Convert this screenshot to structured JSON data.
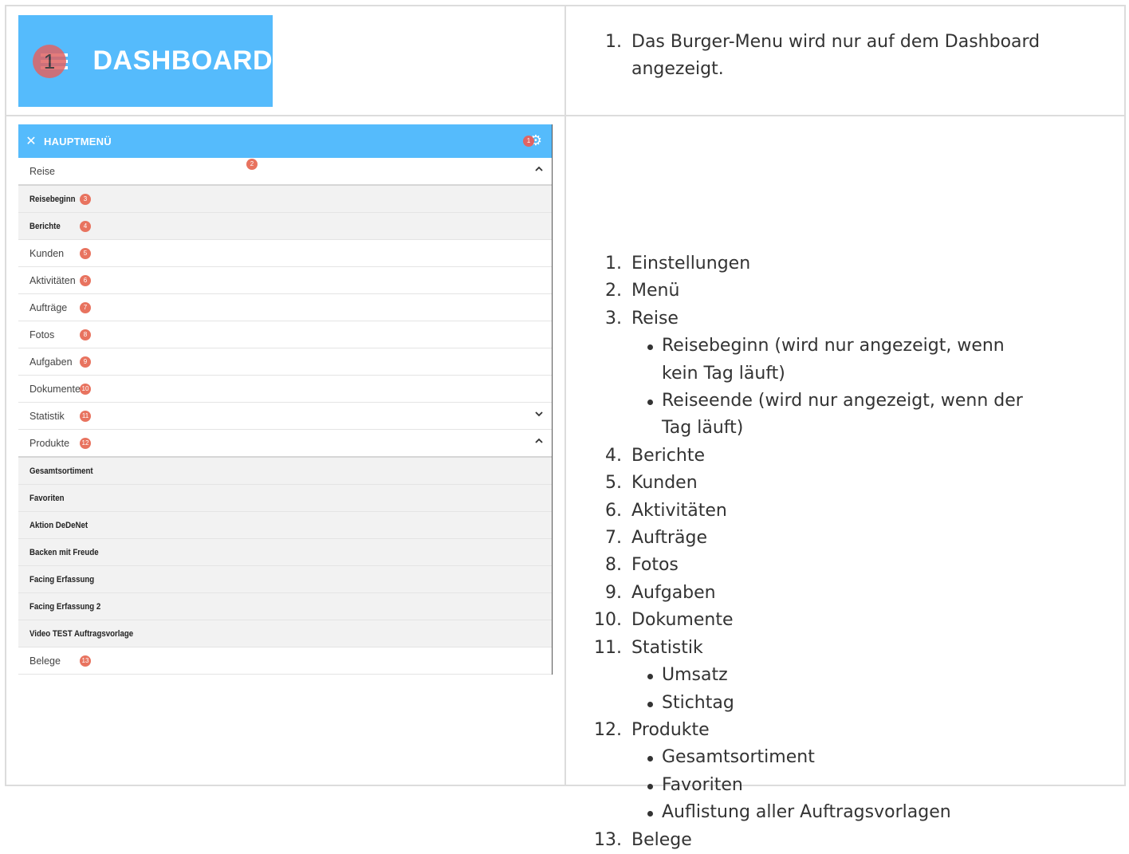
{
  "dashboard": {
    "badge": "1",
    "title": "DASHBOARD",
    "note_number": "1.",
    "note_text": "Das Burger-Menu wird nur auf dem Dashboard angezeigt."
  },
  "menu": {
    "header_title": "HAUPTMENÜ",
    "gear_badge": "1",
    "reise_badge": "2",
    "rows": [
      {
        "label": "Reise",
        "type": "section",
        "chevron": "up"
      },
      {
        "label": "Reisebeginn",
        "type": "sub",
        "badge": "3"
      },
      {
        "label": "Berichte",
        "type": "sub",
        "badge": "4"
      },
      {
        "label": "Kunden",
        "type": "item",
        "badge": "5"
      },
      {
        "label": "Aktivitäten",
        "type": "item",
        "badge": "6"
      },
      {
        "label": "Aufträge",
        "type": "item",
        "badge": "7"
      },
      {
        "label": "Fotos",
        "type": "item",
        "badge": "8"
      },
      {
        "label": "Aufgaben",
        "type": "item",
        "badge": "9"
      },
      {
        "label": "Dokumente",
        "type": "item",
        "badge": "10"
      },
      {
        "label": "Statistik",
        "type": "item",
        "badge": "11",
        "chevron": "down"
      },
      {
        "label": "Produkte",
        "type": "item",
        "badge": "12",
        "chevron": "up"
      },
      {
        "label": "Gesamtsortiment",
        "type": "sub"
      },
      {
        "label": "Favoriten",
        "type": "sub"
      },
      {
        "label": "Aktion DeDeNet",
        "type": "sub"
      },
      {
        "label": "Backen mit Freude",
        "type": "sub"
      },
      {
        "label": "Facing Erfassung",
        "type": "sub"
      },
      {
        "label": "Facing Erfassung 2",
        "type": "sub"
      },
      {
        "label": "Video TEST Auftragsvorlage",
        "type": "sub"
      },
      {
        "label": "Belege",
        "type": "item",
        "badge": "13"
      }
    ]
  },
  "notes": [
    {
      "n": "1.",
      "text": "Einstellungen"
    },
    {
      "n": "2.",
      "text": "Menü"
    },
    {
      "n": "3.",
      "text": "Reise",
      "sub": [
        "Reisebeginn (wird nur angezeigt, wenn kein Tag läuft)",
        "Reiseende (wird nur angezeigt, wenn der Tag läuft)"
      ]
    },
    {
      "n": "4.",
      "text": "Berichte"
    },
    {
      "n": "5.",
      "text": "Kunden"
    },
    {
      "n": "6.",
      "text": "Aktivitäten"
    },
    {
      "n": "7.",
      "text": "Aufträge"
    },
    {
      "n": "8.",
      "text": "Fotos"
    },
    {
      "n": "9.",
      "text": "Aufgaben"
    },
    {
      "n": "10.",
      "text": "Dokumente"
    },
    {
      "n": "11.",
      "text": "Statistik",
      "sub": [
        "Umsatz",
        "Stichtag"
      ]
    },
    {
      "n": "12.",
      "text": "Produkte",
      "sub": [
        "Gesamtsortiment",
        "Favoriten",
        "Auflistung aller Auftragsvorlagen"
      ]
    },
    {
      "n": "13.",
      "text": "Belege"
    }
  ],
  "colors": {
    "banner": "#55bbfc",
    "badge": "#e8735f"
  }
}
